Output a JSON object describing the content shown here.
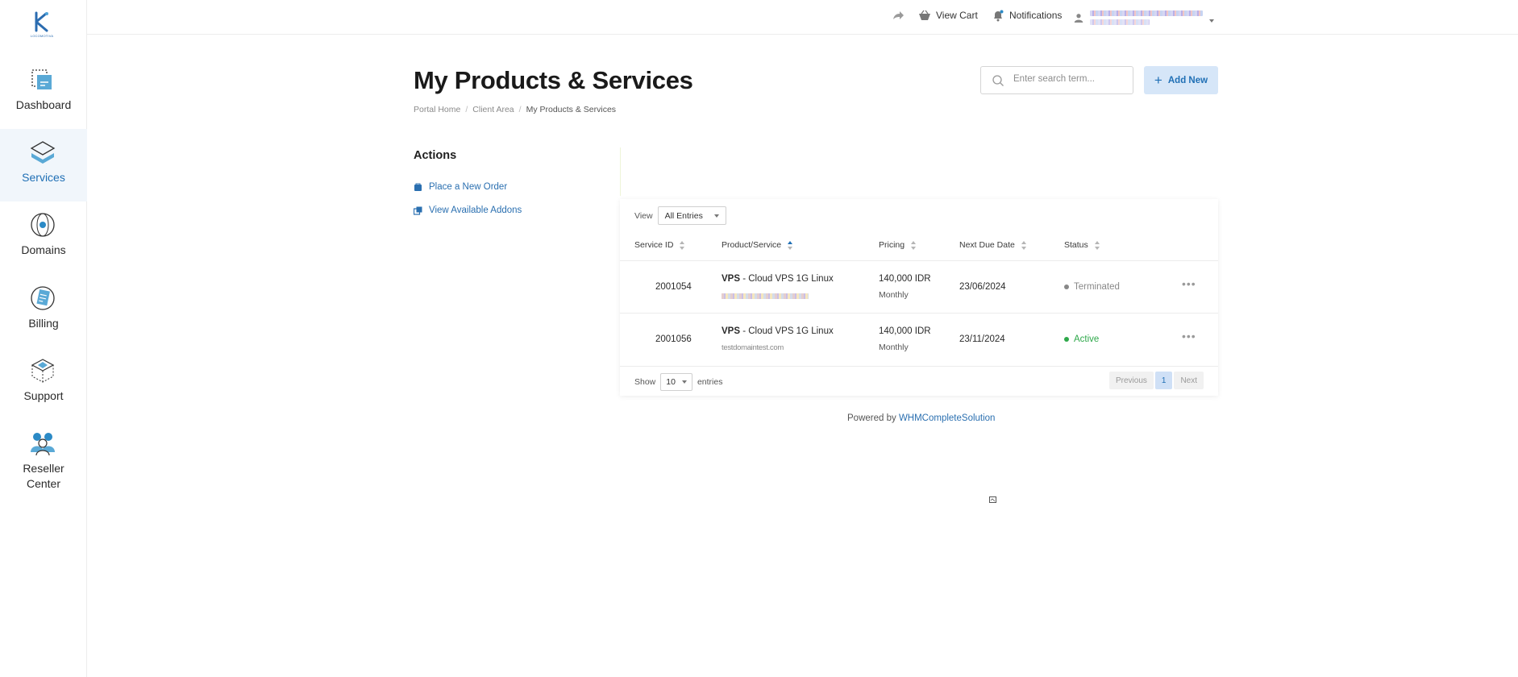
{
  "sidebar": {
    "logo_text": "LOCOMOTIVA",
    "items": [
      {
        "label": "Dashboard",
        "icon": "dashboard-icon"
      },
      {
        "label": "Services",
        "icon": "services-icon",
        "active": true
      },
      {
        "label": "Domains",
        "icon": "domains-icon"
      },
      {
        "label": "Billing",
        "icon": "billing-icon"
      },
      {
        "label": "Support",
        "icon": "support-icon"
      },
      {
        "label": "Reseller Center",
        "icon": "reseller-icon"
      }
    ]
  },
  "topbar": {
    "share_icon": "share-icon",
    "view_cart": "View Cart",
    "notifications": "Notifications",
    "account_icon": "user-icon"
  },
  "page": {
    "title": "My Products & Services",
    "breadcrumb": [
      "Portal Home",
      "Client Area",
      "My Products & Services"
    ]
  },
  "search": {
    "placeholder": "Enter search term..."
  },
  "add_new": {
    "label": "Add New"
  },
  "actions": {
    "title": "Actions",
    "links": [
      {
        "label": "Place a New Order",
        "icon": "cart-icon"
      },
      {
        "label": "View Available Addons",
        "icon": "addons-icon"
      }
    ]
  },
  "table": {
    "view_label": "View",
    "view_value": "All Entries",
    "columns": [
      "Service ID",
      "Product/Service",
      "Pricing",
      "Next Due Date",
      "Status"
    ],
    "rows": [
      {
        "id": "2001054",
        "product_bold": "VPS",
        "product_rest": " - Cloud VPS 1G Linux",
        "price": "140,000 IDR",
        "cycle": "Monthly",
        "due": "23/06/2024",
        "status": "Terminated",
        "status_color": "#888888"
      },
      {
        "id": "2001056",
        "product_bold": "VPS",
        "product_rest": " - Cloud VPS 1G Linux",
        "domain": "testdomaintest.com",
        "price": "140,000 IDR",
        "cycle": "Monthly",
        "due": "23/11/2024",
        "status": "Active",
        "status_color": "#2ea84a"
      }
    ],
    "show_label": "Show",
    "show_value": "10",
    "entries_label": "entries",
    "pager": {
      "previous": "Previous",
      "current": "1",
      "next": "Next"
    }
  },
  "footer": {
    "powered_by": "Powered by",
    "link": "WHMCompleteSolution"
  },
  "colors": {
    "accent": "#1f6fb5",
    "active_status": "#2ea84a",
    "terminated_status": "#888888",
    "add_button_bg": "#d6e6f8"
  }
}
